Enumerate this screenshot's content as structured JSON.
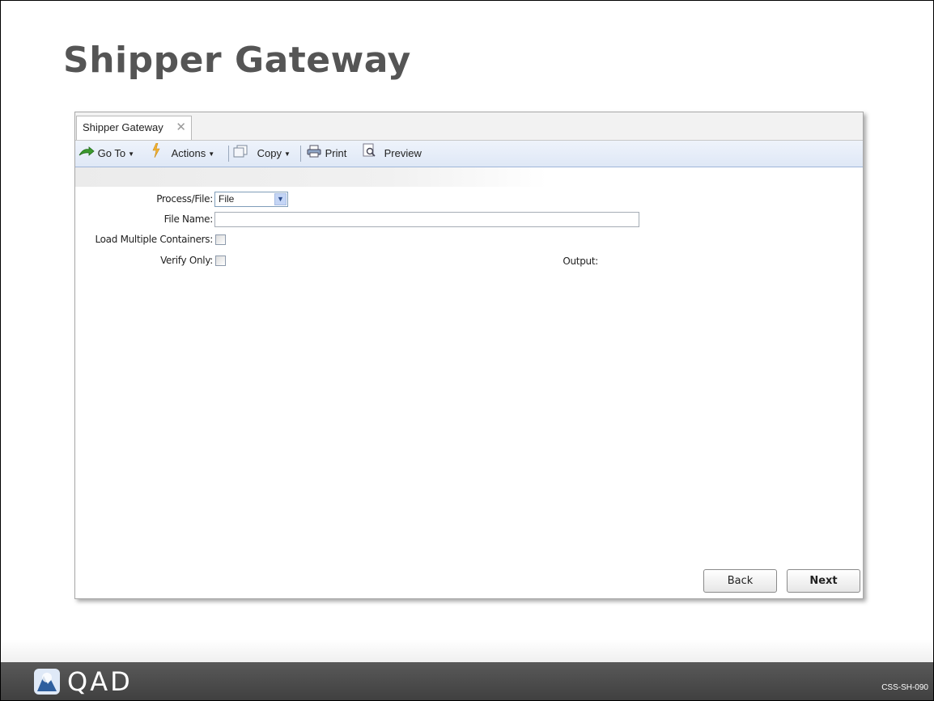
{
  "slide": {
    "title": "Shipper Gateway",
    "code": "CSS-SH-090",
    "logo_text": "QAD"
  },
  "window": {
    "tab_label": "Shipper Gateway",
    "tab_close_glyph": "✕"
  },
  "toolbar": {
    "goto_label": "Go To",
    "actions_label": "Actions",
    "copy_label": "Copy",
    "print_label": "Print",
    "preview_label": "Preview"
  },
  "form": {
    "process_file_label": "Process/File:",
    "process_file_value": "File",
    "file_name_label": "File Name:",
    "file_name_value": "",
    "load_multiple_label": "Load Multiple Containers:",
    "load_multiple_checked": false,
    "verify_only_label": "Verify Only:",
    "verify_only_checked": false,
    "output_label": "Output:"
  },
  "buttons": {
    "back_label": "Back",
    "next_label": "Next"
  },
  "colors": {
    "title_gray": "#555555",
    "toolbar_blue": "#dfe8f6",
    "footer_dark": "#4a4a4a"
  }
}
